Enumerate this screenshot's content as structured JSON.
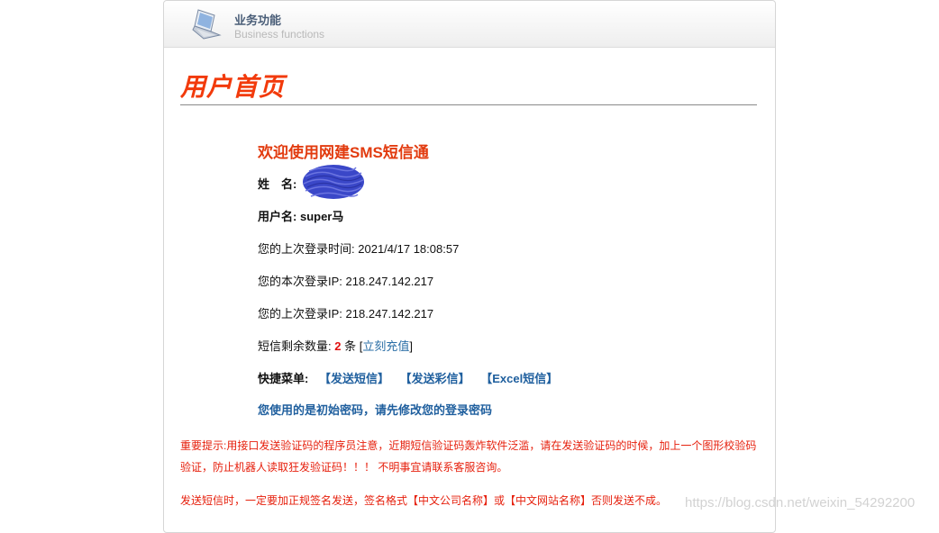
{
  "header": {
    "title": "业务功能",
    "subtitle": "Business functions",
    "icon": "laptop-icon"
  },
  "page": {
    "title": "用户首页"
  },
  "welcome": "欢迎使用网建SMS短信通",
  "user": {
    "name_label": "姓　名:",
    "username_label": "用户名:",
    "username_value": "super马"
  },
  "login": {
    "last_time_label": "您的上次登录时间:",
    "last_time_value": "2021/4/17 18:08:57",
    "current_ip_label": "您的本次登录IP:",
    "current_ip_value": "218.247.142.217",
    "last_ip_label": "您的上次登录IP:",
    "last_ip_value": "218.247.142.217"
  },
  "sms": {
    "remaining_label": "短信剩余数量:",
    "remaining_count": "2",
    "unit": "条",
    "bracket_open": "[",
    "recharge_link": "立刻充值",
    "bracket_close": "]"
  },
  "quick_menu": {
    "label": "快捷菜单:",
    "items": [
      "【发送短信】",
      "【发送彩信】",
      "【Excel短信】"
    ]
  },
  "password_notice": "您使用的是初始密码，请先修改您的登录密码",
  "warnings": {
    "important": "重要提示:用接口发送验证码的程序员注意，近期短信验证码轰炸软件泛滥，请在发送验证码的时候，加上一个图形校验码验证，防止机器人读取狂发验证码！！！ 不明事宜请联系客服咨询。",
    "signature": "发送短信时，一定要加正规签名发送，签名格式【中文公司名称】或【中文网站名称】否则发送不成。"
  },
  "watermark": "https://blog.csdn.net/weixin_54292200",
  "colors": {
    "title_red": "#f23a0b",
    "warning_red": "#e6200d",
    "link_blue": "#1f5f9e",
    "scribble_blue": "#3a47c8"
  }
}
